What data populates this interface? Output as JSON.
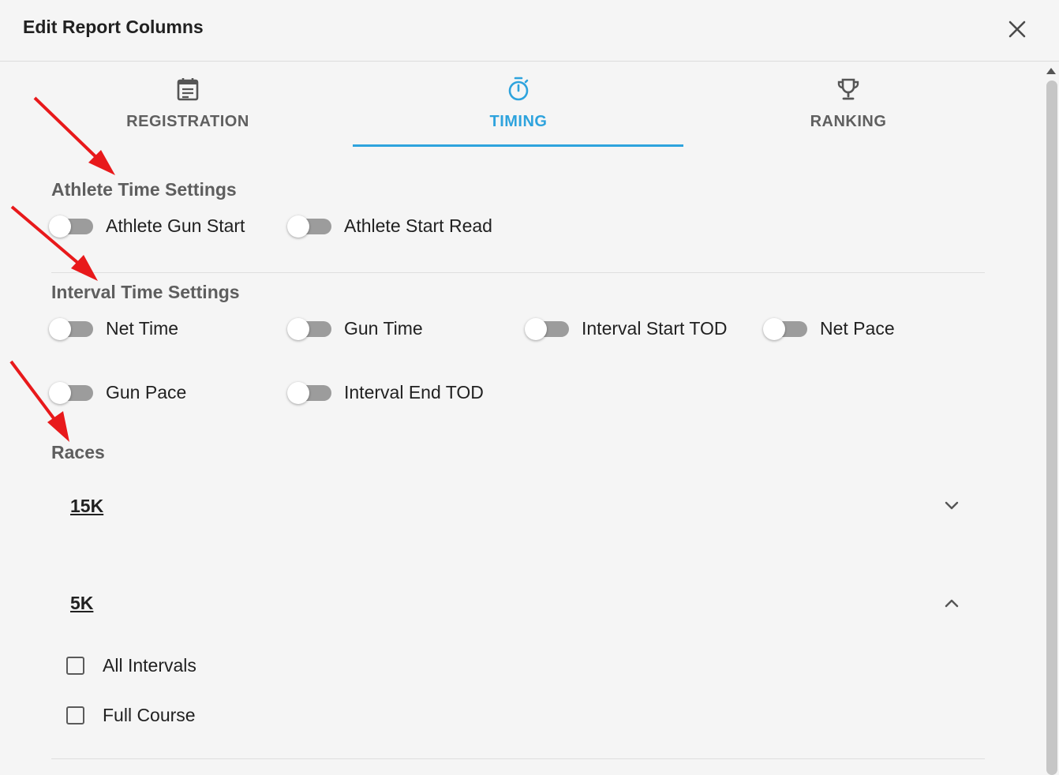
{
  "dialog": {
    "title": "Edit Report Columns",
    "close_icon": "close-icon"
  },
  "tabs": [
    {
      "label": "REGISTRATION",
      "icon": "calendar-note-icon",
      "active": false
    },
    {
      "label": "TIMING",
      "icon": "stopwatch-icon",
      "active": true
    },
    {
      "label": "RANKING",
      "icon": "trophy-icon",
      "active": false
    }
  ],
  "athlete_time_settings": {
    "title": "Athlete Time Settings",
    "toggles": [
      {
        "label": "Athlete Gun Start",
        "on": false
      },
      {
        "label": "Athlete Start Read",
        "on": false
      }
    ]
  },
  "interval_time_settings": {
    "title": "Interval Time Settings",
    "toggles": [
      {
        "label": "Net Time",
        "on": false
      },
      {
        "label": "Gun Time",
        "on": false
      },
      {
        "label": "Interval Start TOD",
        "on": false
      },
      {
        "label": "Net Pace",
        "on": false
      },
      {
        "label": "Gun Pace",
        "on": false
      },
      {
        "label": "Interval End TOD",
        "on": false
      }
    ]
  },
  "races": {
    "title": "Races",
    "items": [
      {
        "name": "15K",
        "expanded": false
      },
      {
        "name": "5K",
        "expanded": true,
        "options": [
          {
            "label": "All Intervals",
            "checked": false
          },
          {
            "label": "Full Course",
            "checked": false
          }
        ]
      }
    ]
  },
  "colors": {
    "accent": "#2ea3dd",
    "annotation_arrow": "#e8191b",
    "toggle_track": "#9c9c9c",
    "section_title": "#5e5e5e"
  }
}
